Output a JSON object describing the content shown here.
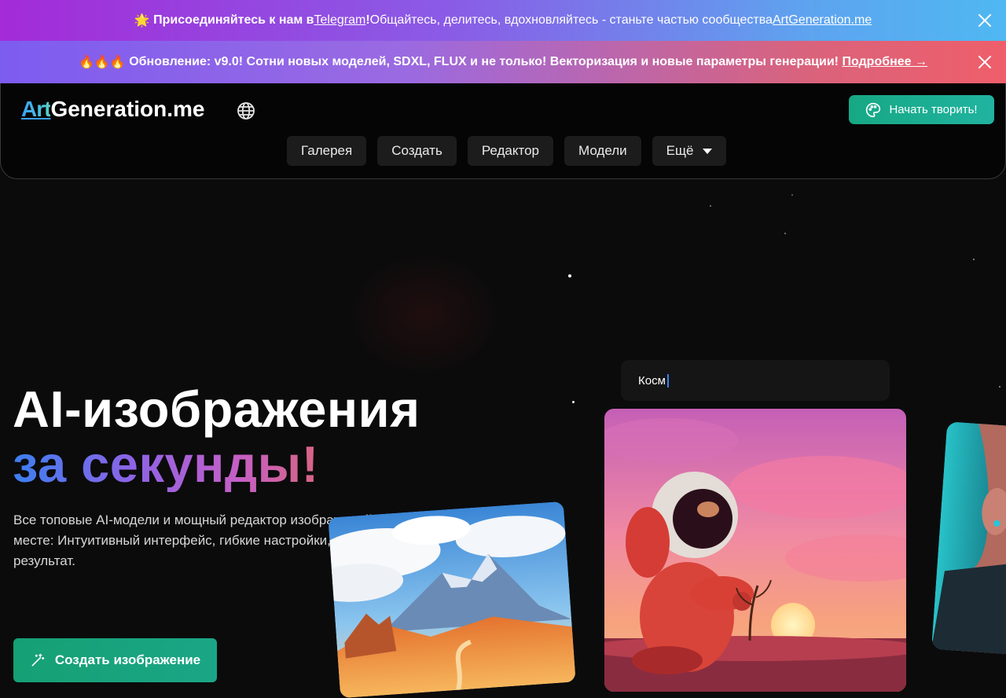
{
  "banners": {
    "telegram": {
      "emoji": "🌟",
      "text_bold": "Присоединяйтесь к нам в ",
      "link": "Telegram",
      "text_bold_end": "!",
      "text_rest": " Общайтесь, делитесь, вдохновляйтесь - станьте частью сообщества ",
      "site_link": "ArtGeneration.me"
    },
    "update": {
      "emoji": "🔥🔥🔥",
      "text": "Обновление: v9.0! Сотни новых моделей, SDXL, FLUX и не только! Векторизация и новые параметры генерации!",
      "link": "Подробнее →"
    }
  },
  "header": {
    "logo_art": "Art",
    "logo_rest": "Generation.me",
    "cta": "Начать творить!",
    "nav": [
      "Галерея",
      "Создать",
      "Редактор",
      "Модели",
      "Ещё"
    ]
  },
  "hero": {
    "title_line1": "AI-изображения",
    "title_line2": "за секунды!",
    "description": "Все топовые AI-модели и мощный редактор изображений в одном месте: Интуитивный интерфейс, гибкие настройки, мгновенный результат.",
    "cta": "Создать изображение"
  },
  "prompt": {
    "value": "Косм"
  },
  "colors": {
    "accent_green": "#17a884",
    "gradient_blue": "#3b7ff0",
    "gradient_purple": "#8f63e6",
    "gradient_orange": "#e8684f"
  },
  "icons": {
    "globe": "globe-icon",
    "palette": "palette-icon",
    "wand": "magic-wand-icon",
    "close": "close-icon",
    "caret": "caret-down-icon"
  }
}
